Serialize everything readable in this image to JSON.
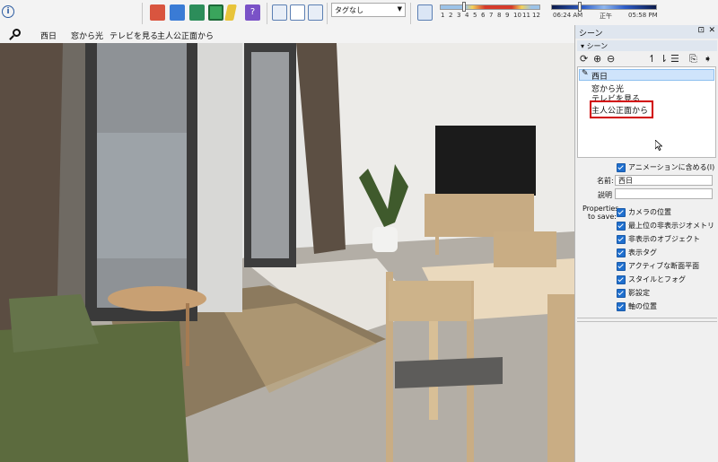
{
  "toolbar": {
    "tag_select_value": "タグなし",
    "months": [
      "1",
      "2",
      "3",
      "4",
      "5",
      "6",
      "7",
      "8",
      "9",
      "10",
      "11",
      "12"
    ],
    "time_start": "06:24 AM",
    "time_noon": "正午",
    "time_end": "05:58 PM"
  },
  "scene_tabs": [
    "西日",
    "窓から光",
    "テレビを見る",
    "主人公正面から"
  ],
  "panel": {
    "title": "シーン",
    "section": "シーン",
    "scenes": [
      "西日",
      "窓から光",
      "テレビを見る",
      "主人公正面から"
    ],
    "selected_scene": "西日",
    "include_animation_label": "アニメーションに含める(I)",
    "name_label": "名前:",
    "name_value": "西日",
    "description_label": "説明",
    "description_value": "",
    "properties_label_1": "Properties",
    "properties_label_2": "to save:",
    "properties": [
      "カメラの位置",
      "最上位の非表示ジオメトリ",
      "非表示のオブジェクト",
      "表示タグ",
      "アクティブな断面平面",
      "スタイルとフォグ",
      "影設定",
      "軸の位置"
    ]
  },
  "colors": {
    "accent_blue": "#1f6fce",
    "highlight_red": "#d10000",
    "selection_blue": "#cfe4fb"
  }
}
